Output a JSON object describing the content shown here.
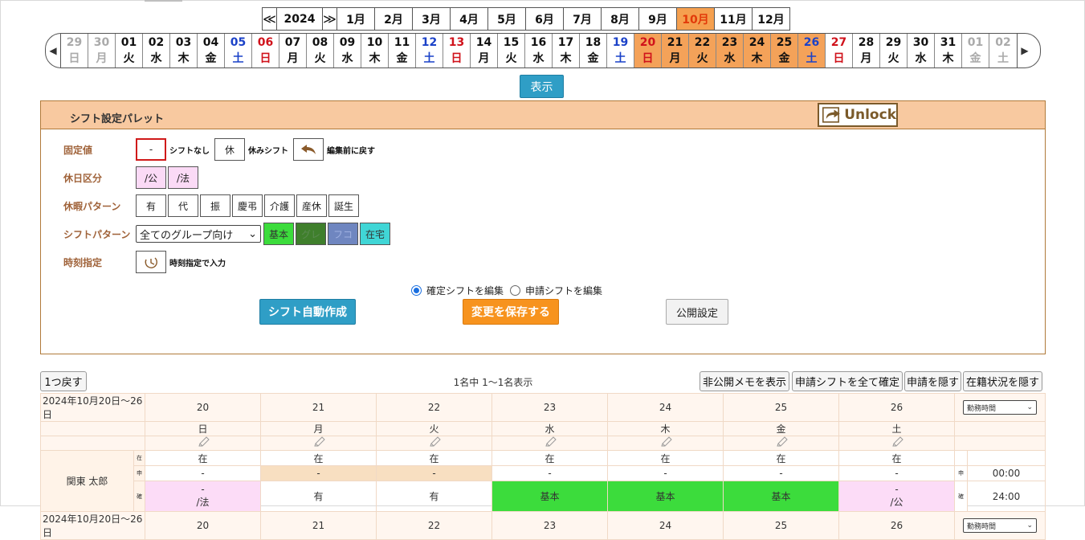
{
  "monthbar": {
    "prev_year": "≪",
    "year": "2024",
    "next_year": "≫",
    "months": [
      "1月",
      "2月",
      "3月",
      "4月",
      "5月",
      "6月",
      "7月",
      "8月",
      "9月",
      "10月",
      "11月",
      "12月"
    ],
    "selected_month": "10月"
  },
  "daystrip": {
    "prev": "◀",
    "next": "▶",
    "days": [
      {
        "d": "29",
        "w": "日",
        "t": "gray"
      },
      {
        "d": "30",
        "w": "月",
        "t": "gray"
      },
      {
        "d": "01",
        "w": "火",
        "t": ""
      },
      {
        "d": "02",
        "w": "水",
        "t": ""
      },
      {
        "d": "03",
        "w": "木",
        "t": ""
      },
      {
        "d": "04",
        "w": "金",
        "t": ""
      },
      {
        "d": "05",
        "w": "土",
        "t": "sat"
      },
      {
        "d": "06",
        "w": "日",
        "t": "sun"
      },
      {
        "d": "07",
        "w": "月",
        "t": ""
      },
      {
        "d": "08",
        "w": "火",
        "t": ""
      },
      {
        "d": "09",
        "w": "水",
        "t": ""
      },
      {
        "d": "10",
        "w": "木",
        "t": ""
      },
      {
        "d": "11",
        "w": "金",
        "t": ""
      },
      {
        "d": "12",
        "w": "土",
        "t": "sat"
      },
      {
        "d": "13",
        "w": "日",
        "t": "sun"
      },
      {
        "d": "14",
        "w": "月",
        "t": ""
      },
      {
        "d": "15",
        "w": "火",
        "t": ""
      },
      {
        "d": "16",
        "w": "水",
        "t": ""
      },
      {
        "d": "17",
        "w": "木",
        "t": ""
      },
      {
        "d": "18",
        "w": "金",
        "t": ""
      },
      {
        "d": "19",
        "w": "土",
        "t": "sat"
      },
      {
        "d": "20",
        "w": "日",
        "t": "sun hl"
      },
      {
        "d": "21",
        "w": "月",
        "t": "hl"
      },
      {
        "d": "22",
        "w": "火",
        "t": "hl"
      },
      {
        "d": "23",
        "w": "水",
        "t": "hl"
      },
      {
        "d": "24",
        "w": "木",
        "t": "hl"
      },
      {
        "d": "25",
        "w": "金",
        "t": "hl"
      },
      {
        "d": "26",
        "w": "土",
        "t": "sat hl"
      },
      {
        "d": "27",
        "w": "日",
        "t": "sun"
      },
      {
        "d": "28",
        "w": "月",
        "t": ""
      },
      {
        "d": "29",
        "w": "火",
        "t": ""
      },
      {
        "d": "30",
        "w": "水",
        "t": ""
      },
      {
        "d": "31",
        "w": "木",
        "t": ""
      },
      {
        "d": "01",
        "w": "金",
        "t": "gray"
      },
      {
        "d": "02",
        "w": "土",
        "t": "gray"
      }
    ]
  },
  "show_button": "表示",
  "palette": {
    "title": "シフト設定パレット",
    "unlock": "Unlock",
    "fixed_label": "固定値",
    "fixed_dash": "-",
    "no_shift": "シフトなし",
    "rest": "休",
    "rest_shift": "休みシフト",
    "revert": "編集前に戻す",
    "holiday_label": "休日区分",
    "holiday_items": [
      "/公",
      "/法"
    ],
    "leave_label": "休暇パターン",
    "leave_items": [
      "有",
      "代",
      "振",
      "慶弔",
      "介護",
      "産休",
      "誕生"
    ],
    "shift_label": "シフトパターン",
    "group_select": "全てのグループ向け",
    "shift_items": [
      "基本",
      "グレ",
      "フコ",
      "在宅"
    ],
    "time_label": "時刻指定",
    "time_input": "時刻指定で入力",
    "radio_confirmed": "確定シフトを編集",
    "radio_request": "申請シフトを編集",
    "auto_button": "シフト自動作成",
    "save_button": "変更を保存する",
    "publish_button": "公開設定"
  },
  "toolbar": {
    "back": "1つ戻す",
    "count": "1名中 1〜1名表示",
    "private_memo": "非公開メモを表示",
    "confirm_all": "申請シフトを全て確定",
    "hide_request": "申請を隠す",
    "hide_status": "在籍状況を隠す"
  },
  "schedule": {
    "range": "2024年10月20日〜26日",
    "days": [
      "20",
      "21",
      "22",
      "23",
      "24",
      "25",
      "26"
    ],
    "weekdays": [
      "日",
      "月",
      "火",
      "水",
      "木",
      "金",
      "土"
    ],
    "metric_select": "勤務時間",
    "employee": "関東 太郎",
    "row_zai_tag": "在",
    "row_shin_tag": "申",
    "row_kaku_tag": "確",
    "zai": [
      "在",
      "在",
      "在",
      "在",
      "在",
      "在",
      "在"
    ],
    "shin": [
      "-",
      "-",
      "-",
      "-",
      "-",
      "-",
      "-"
    ],
    "kaku_top": [
      "-",
      "",
      "",
      "",
      "",
      "",
      "-"
    ],
    "kaku": [
      "/法",
      "有",
      "有",
      "基本",
      "基本",
      "基本",
      "/公"
    ],
    "shin_total": "00:00",
    "kaku_total": "24:00",
    "next_range": "2024年10月20日〜26日",
    "next_days": [
      "20",
      "21",
      "22",
      "23",
      "24",
      "25",
      "26"
    ],
    "next_select": "勤務時間"
  }
}
